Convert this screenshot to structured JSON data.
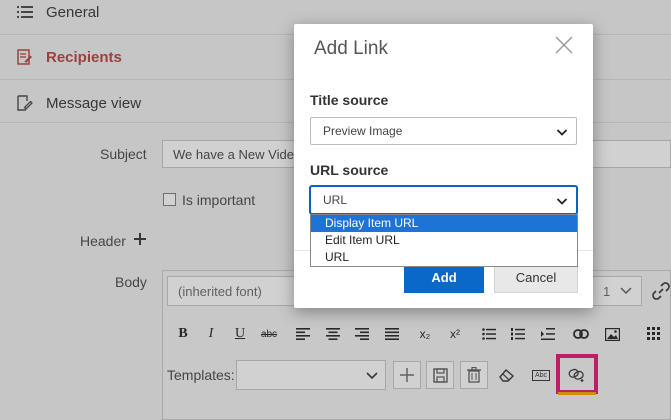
{
  "nav": {
    "items": [
      {
        "label": "General",
        "icon": "list-icon"
      },
      {
        "label": "Recipients",
        "icon": "edit-doc-icon"
      },
      {
        "label": "Message view",
        "icon": "doc-pen-icon"
      }
    ]
  },
  "form": {
    "subject_label": "Subject",
    "subject_value": "We have a New Video o",
    "important_label": "Is important",
    "header_label": "Header",
    "body_label": "Body",
    "font_value": "(inherited font)",
    "size_value": "1",
    "templates_label": "Templates:"
  },
  "toolbar": {
    "bold": "B",
    "italic": "I",
    "underline": "U",
    "strike": "abc",
    "subscript": "x₂",
    "superscript": "x²",
    "abc_box": "Abc"
  },
  "modal": {
    "title": "Add Link",
    "title_source_label": "Title source",
    "title_source_value": "Preview Image",
    "url_source_label": "URL source",
    "url_source_value": "URL",
    "options": [
      "Display Item URL",
      "Edit Item URL",
      "URL"
    ],
    "selected_option": "Display Item URL",
    "add_label": "Add",
    "cancel_label": "Cancel"
  },
  "colors": {
    "accent": "#0a68c8",
    "highlight": "#e8257d",
    "active_nav": "#c0504d"
  }
}
